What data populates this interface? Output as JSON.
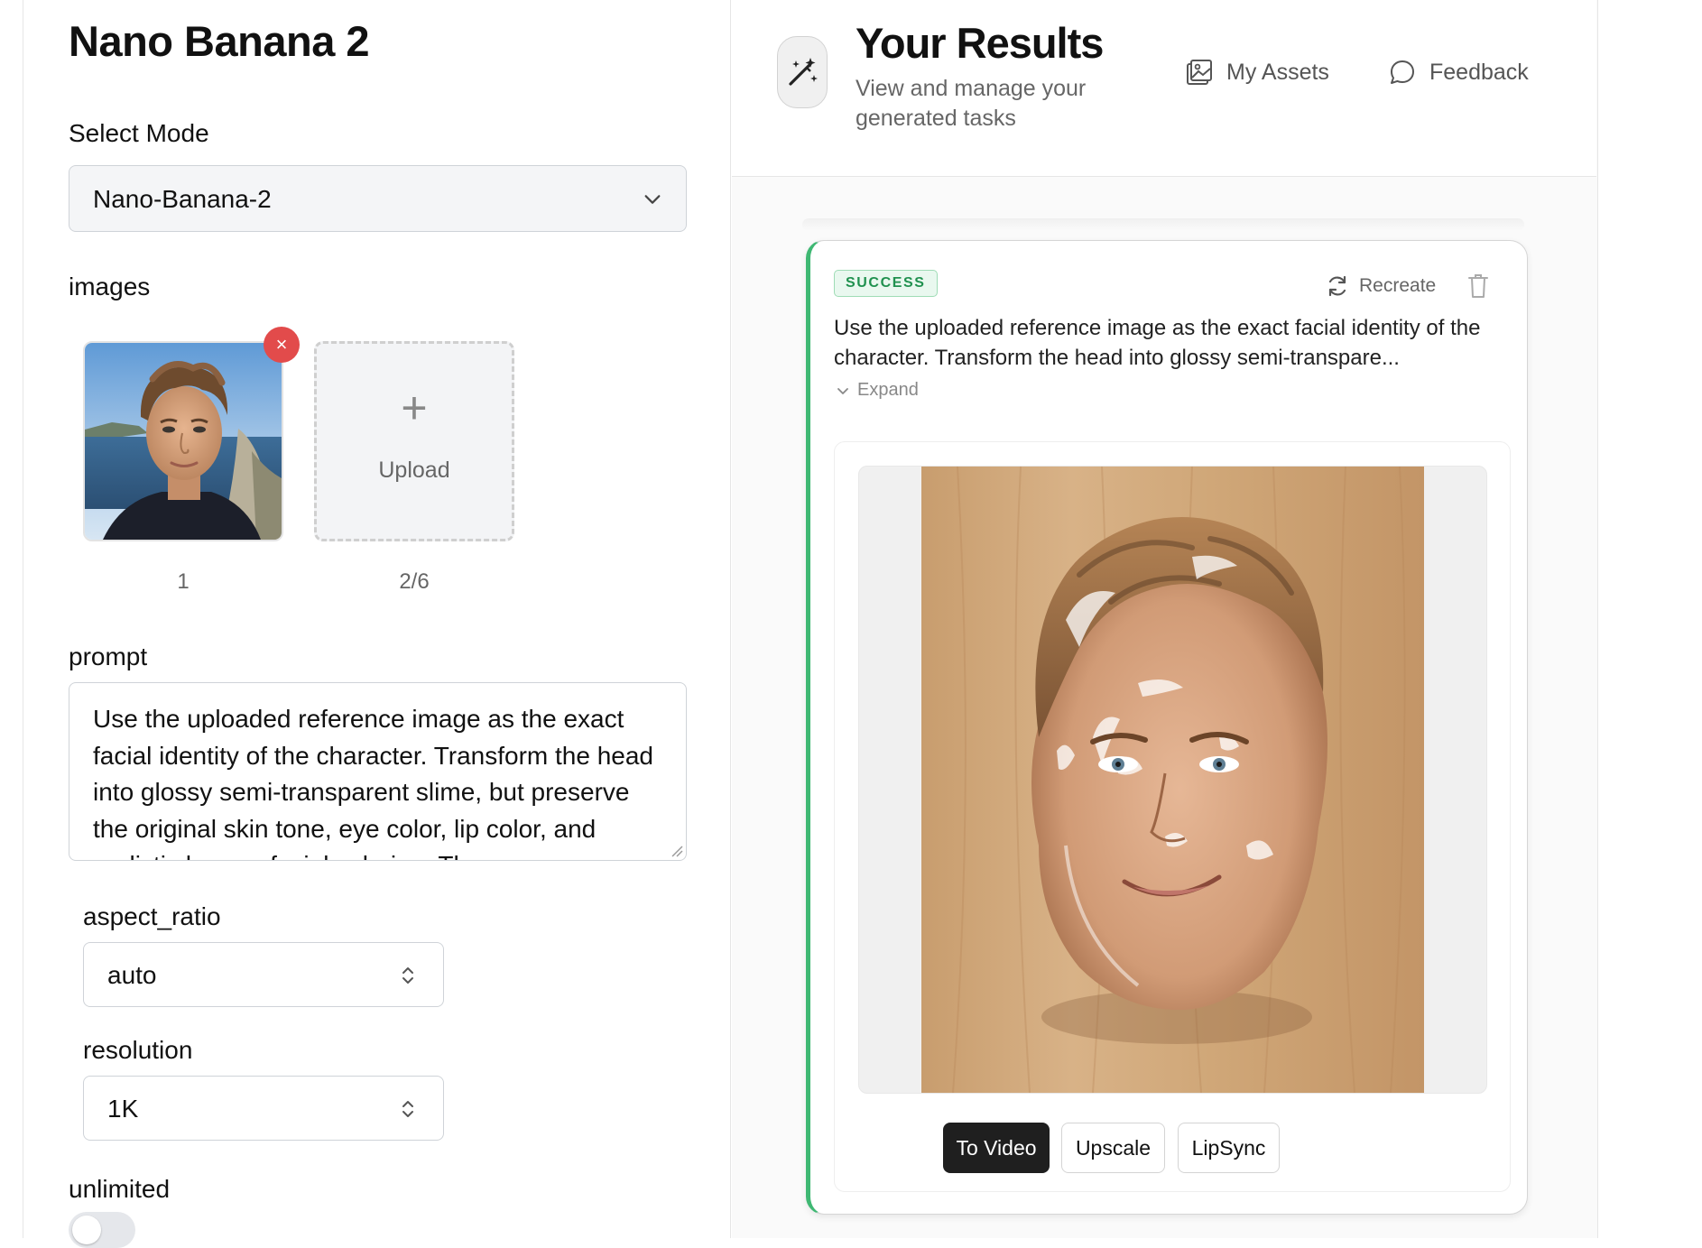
{
  "left": {
    "title": "Nano Banana 2",
    "select_mode": {
      "label": "Select Mode",
      "value": "Nano-Banana-2"
    },
    "images": {
      "label": "images",
      "items": [
        {
          "caption": "1"
        }
      ],
      "upload_label": "Upload",
      "count": "2/6"
    },
    "prompt": {
      "label": "prompt",
      "value": "Use the uploaded reference image as the exact facial identity of the character. Transform the head into glossy semi-transparent slime, but preserve the original skin tone, eye color, lip color, and realistic human facial coloring. The"
    },
    "aspect_ratio": {
      "label": "aspect_ratio",
      "value": "auto"
    },
    "resolution": {
      "label": "resolution",
      "value": "1K"
    },
    "unlimited": {
      "label": "unlimited",
      "on": false
    }
  },
  "right": {
    "title": "Your Results",
    "subtitle": "View and manage your generated tasks",
    "nav": {
      "assets": "My Assets",
      "feedback": "Feedback"
    },
    "task": {
      "status": "SUCCESS",
      "recreate": "Recreate",
      "prompt_preview": "Use the uploaded reference image as the exact facial identity of the character. Transform the head into glossy semi-transpare...",
      "expand": "Expand",
      "actions": {
        "to_video": "To Video",
        "upscale": "Upscale",
        "lipsync": "LipSync"
      }
    }
  },
  "colors": {
    "success_green": "#3fb873",
    "danger_red": "#e24b4b",
    "dark_button": "#1f1f1f"
  }
}
